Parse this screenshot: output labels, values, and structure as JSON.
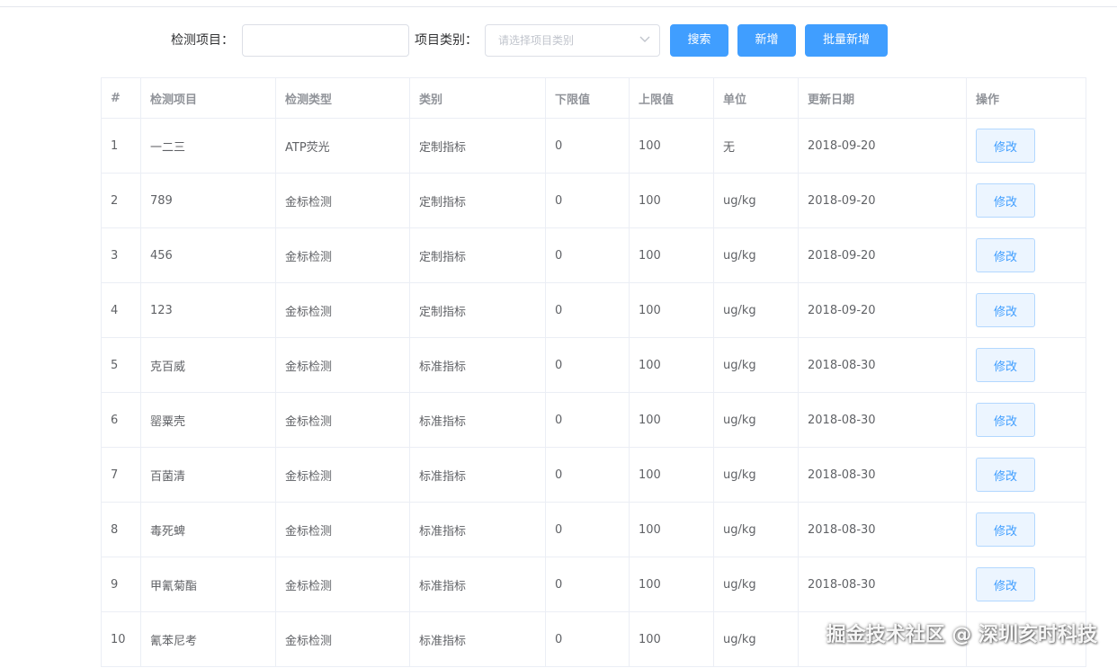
{
  "search": {
    "item_label": "检测项目：",
    "item_value": "",
    "item_placeholder": "",
    "category_label": "项目类别：",
    "category_placeholder": "请选择项目类别",
    "search_button": "搜索",
    "add_button": "新增",
    "batch_add_button": "批量新增"
  },
  "colors": {
    "primary": "#409eff",
    "border": "#ebeef5",
    "header_text": "#909399",
    "body_text": "#606266"
  },
  "table": {
    "headers": [
      "#",
      "检测项目",
      "检测类型",
      "类别",
      "下限值",
      "上限值",
      "单位",
      "更新日期",
      "操作"
    ],
    "rows": [
      {
        "index": "1",
        "item": "一二三",
        "type": "ATP荧光",
        "category": "定制指标",
        "min": "0",
        "max": "100",
        "unit": "无",
        "date": "2018-09-20",
        "action": "修改"
      },
      {
        "index": "2",
        "item": "789",
        "type": "金标检测",
        "category": "定制指标",
        "min": "0",
        "max": "100",
        "unit": "ug/kg",
        "date": "2018-09-20",
        "action": "修改"
      },
      {
        "index": "3",
        "item": "456",
        "type": "金标检测",
        "category": "定制指标",
        "min": "0",
        "max": "100",
        "unit": "ug/kg",
        "date": "2018-09-20",
        "action": "修改"
      },
      {
        "index": "4",
        "item": "123",
        "type": "金标检测",
        "category": "定制指标",
        "min": "0",
        "max": "100",
        "unit": "ug/kg",
        "date": "2018-09-20",
        "action": "修改"
      },
      {
        "index": "5",
        "item": "克百威",
        "type": "金标检测",
        "category": "标准指标",
        "min": "0",
        "max": "100",
        "unit": "ug/kg",
        "date": "2018-08-30",
        "action": "修改"
      },
      {
        "index": "6",
        "item": "罂粟壳",
        "type": "金标检测",
        "category": "标准指标",
        "min": "0",
        "max": "100",
        "unit": "ug/kg",
        "date": "2018-08-30",
        "action": "修改"
      },
      {
        "index": "7",
        "item": "百菌清",
        "type": "金标检测",
        "category": "标准指标",
        "min": "0",
        "max": "100",
        "unit": "ug/kg",
        "date": "2018-08-30",
        "action": "修改"
      },
      {
        "index": "8",
        "item": "毒死蜱",
        "type": "金标检测",
        "category": "标准指标",
        "min": "0",
        "max": "100",
        "unit": "ug/kg",
        "date": "2018-08-30",
        "action": "修改"
      },
      {
        "index": "9",
        "item": "甲氰菊酯",
        "type": "金标检测",
        "category": "标准指标",
        "min": "0",
        "max": "100",
        "unit": "ug/kg",
        "date": "2018-08-30",
        "action": "修改"
      },
      {
        "index": "10",
        "item": "氰苯尼考",
        "type": "金标检测",
        "category": "标准指标",
        "min": "0",
        "max": "100",
        "unit": "ug/kg",
        "date": "",
        "action": ""
      }
    ]
  },
  "watermark": "掘金技术社区 @ 深圳亥时科技"
}
